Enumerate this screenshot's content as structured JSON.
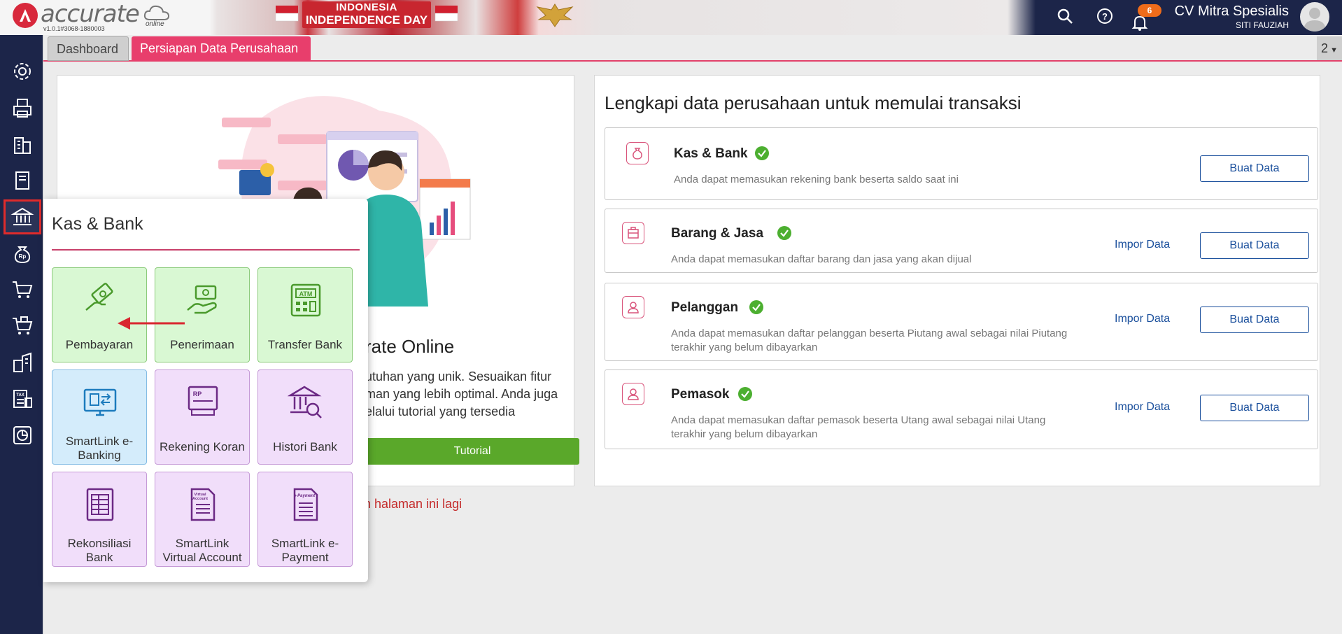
{
  "header": {
    "brand": "accurate",
    "brand_sub": "online",
    "version": "v1.0.1#3068-1880003",
    "banner_line1": "INDONESIA",
    "banner_line2": "INDEPENDENCE DAY",
    "notification_count": "6",
    "company": "CV Mitra Spesialis",
    "user": "SITI FAUZIAH",
    "icons": [
      "search-icon",
      "help-icon",
      "bell-icon",
      "avatar"
    ]
  },
  "sidebar": {
    "items": [
      {
        "name": "settings",
        "icon": "gear-icon"
      },
      {
        "name": "printer",
        "icon": "printer-icon"
      },
      {
        "name": "company",
        "icon": "building-icon"
      },
      {
        "name": "ledger",
        "icon": "book-icon"
      },
      {
        "name": "kas-bank",
        "icon": "bank-icon",
        "active": true
      },
      {
        "name": "receivable",
        "icon": "money-bag-icon"
      },
      {
        "name": "sales",
        "icon": "cart-icon"
      },
      {
        "name": "purchase",
        "icon": "cart-box-icon"
      },
      {
        "name": "inventory",
        "icon": "warehouse-icon"
      },
      {
        "name": "tax",
        "icon": "tax-icon"
      },
      {
        "name": "reports",
        "icon": "chart-icon"
      }
    ]
  },
  "tabs": {
    "dashboard": "Dashboard",
    "persiapan": "Persiapan Data Perusahaan",
    "count": "2"
  },
  "left_card": {
    "title_partial": "rate Online",
    "desc_partial": "utuhan yang unik. Sesuaikan fitur man yang lebih optimal. Anda juga elalui tutorial yang tersedia",
    "tutorial_button": "Tutorial",
    "hide_link_partial": "n halaman ini lagi"
  },
  "right_card": {
    "title": "Lengkapi data perusahaan untuk memulai transaksi",
    "items": [
      {
        "name": "Kas & Bank",
        "desc": "Anda dapat memasukan rekening bank beserta saldo saat ini",
        "impor": "",
        "buat": "Buat Data"
      },
      {
        "name": "Barang & Jasa",
        "desc": "Anda dapat memasukan daftar barang dan jasa yang akan dijual",
        "impor": "Impor Data",
        "buat": "Buat Data"
      },
      {
        "name": "Pelanggan",
        "desc": "Anda dapat memasukan daftar pelanggan beserta Piutang awal sebagai nilai Piutang terakhir yang belum dibayarkan",
        "impor": "Impor Data",
        "buat": "Buat Data"
      },
      {
        "name": "Pemasok",
        "desc": "Anda dapat memasukan daftar pemasok beserta Utang awal sebagai nilai Utang terakhir yang belum dibayarkan",
        "impor": "Impor Data",
        "buat": "Buat Data"
      }
    ]
  },
  "flyout": {
    "title": "Kas & Bank",
    "tiles": [
      {
        "label": "Pembayaran",
        "icon": "payment-hand-icon",
        "color": "#d9f8d3"
      },
      {
        "label": "Penerimaan",
        "icon": "receive-money-icon",
        "color": "#d9f8d3"
      },
      {
        "label": "Transfer Bank",
        "icon": "atm-icon",
        "color": "#d9f8d3"
      },
      {
        "label": "SmartLink e-Banking",
        "icon": "ebanking-icon",
        "color": "#d4ecfb"
      },
      {
        "label": "Rekening Koran",
        "icon": "statement-icon",
        "color": "#f1defa"
      },
      {
        "label": "Histori Bank",
        "icon": "bank-history-icon",
        "color": "#f1defa"
      },
      {
        "label": "Rekonsiliasi Bank",
        "icon": "reconcile-icon",
        "color": "#f1defa"
      },
      {
        "label": "SmartLink Virtual Account",
        "icon": "virtual-account-icon",
        "color": "#f1defa"
      },
      {
        "label": "SmartLink e-Payment",
        "icon": "epayment-icon",
        "color": "#f1defa"
      }
    ]
  },
  "colors": {
    "nav_bg": "#1c2549",
    "accent_pink": "#e83e6c",
    "link_blue": "#1a4f9c",
    "tutorial_green": "#5aa82a",
    "check_green": "#4caf30"
  }
}
